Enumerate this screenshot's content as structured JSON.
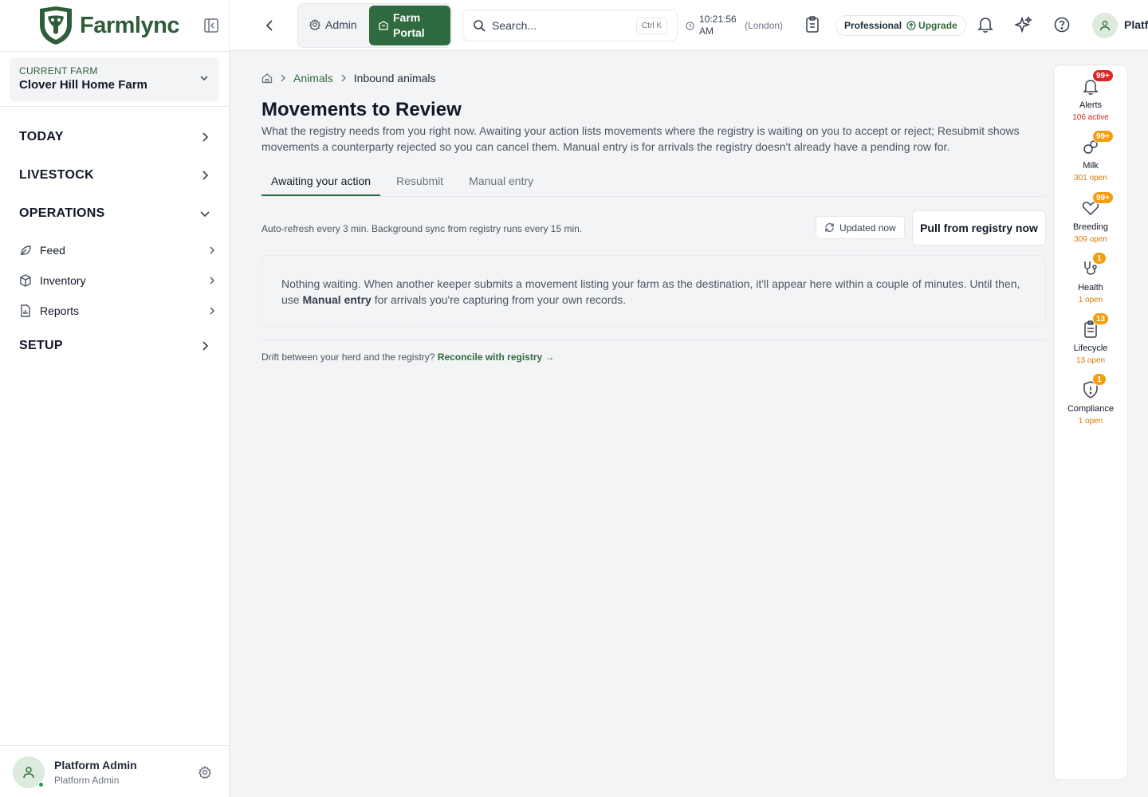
{
  "brand": {
    "name": "Farmlync"
  },
  "current_farm": {
    "label": "CURRENT FARM",
    "value": "Clover Hill Home Farm"
  },
  "nav": {
    "today": "TODAY",
    "livestock": "LIVESTOCK",
    "operations": "OPERATIONS",
    "feed": "Feed",
    "inventory": "Inventory",
    "reports": "Reports",
    "setup": "SETUP"
  },
  "user": {
    "name": "Platform Admin",
    "role": "Platform Admin"
  },
  "topbar": {
    "admin_label": "Admin",
    "farm_portal_line1": "Farm",
    "farm_portal_line2": "Portal",
    "search_placeholder": "Search...",
    "search_shortcut": "Ctrl K",
    "time_line1": "10:21:56",
    "time_line2": "AM",
    "timezone": "(London)",
    "plan_tier": "Professional",
    "upgrade_label": "Upgrade",
    "user_name": "Platf"
  },
  "breadcrumb": {
    "root": "Animals",
    "current": "Inbound animals"
  },
  "page": {
    "title": "Movements to Review",
    "description": "What the registry needs from you right now. Awaiting your action lists movements where the registry is waiting on you to accept or reject; Resubmit shows movements a counterparty rejected so you can cancel them. Manual entry is for arrivals the registry doesn't already have a pending row for."
  },
  "tabs": [
    {
      "label": "Awaiting your action",
      "active": true
    },
    {
      "label": "Resubmit",
      "active": false
    },
    {
      "label": "Manual entry",
      "active": false
    }
  ],
  "toolbar": {
    "refresh_note": "Auto-refresh every 3 min. Background sync from registry runs every 15 min.",
    "updated_label": "Updated now",
    "pull_label": "Pull from registry now"
  },
  "empty_state": {
    "text_before": "Nothing waiting. When another keeper submits a movement listing your farm as the destination, it'll appear here within a couple of minutes. Until then, use ",
    "emphasis": "Manual entry",
    "text_after": " for arrivals you're capturing from your own records."
  },
  "drift": {
    "prefix": "Drift between your herd and the registry?",
    "link": "Reconcile with registry →"
  },
  "rail": {
    "alerts": {
      "label": "Alerts",
      "badge": "99+",
      "count": "106 active",
      "icon": "bell-icon"
    },
    "milk": {
      "label": "Milk",
      "badge": "99+",
      "count": "301 open",
      "icon": "milk-drops-icon"
    },
    "breeding": {
      "label": "Breeding",
      "badge": "99+",
      "count": "309 open",
      "icon": "heart-icon"
    },
    "health": {
      "label": "Health",
      "badge": "1",
      "count": "1 open",
      "icon": "stethoscope-icon"
    },
    "lifecycle": {
      "label": "Lifecycle",
      "badge": "13",
      "count": "13 open",
      "icon": "clipboard-icon"
    },
    "compliance": {
      "label": "Compliance",
      "badge": "1",
      "count": "1 open",
      "icon": "shield-alert-icon"
    }
  },
  "colors": {
    "brand_green": "#2f6b3e",
    "badge_red": "#dc2626",
    "badge_amber": "#f59e0b",
    "alerts_count": "#dc2626",
    "open_count": "#d97706"
  }
}
